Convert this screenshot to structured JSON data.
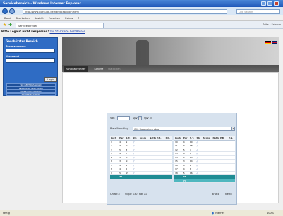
{
  "window": {
    "title": "Servicebereich - Windows Internet Explorer"
  },
  "address": {
    "url": "http://www.golfsuite.de/handicap/login.html",
    "search_placeholder": "Live Search"
  },
  "menu": [
    "Datei",
    "Bearbeiten",
    "Ansicht",
    "Favoriten",
    "Extras",
    "?"
  ],
  "tab": {
    "label": "Servicebereich"
  },
  "favbar_right": "Seite • Extras •",
  "page": {
    "logout_text": "Bitte Logout nicht vergessen!",
    "logout_link": "zur Startseite Golf Kaiser"
  },
  "sidebar": {
    "header": "Geschützter Bereich",
    "username_label": "Benutzername",
    "password_label": "Kennwort",
    "login_button": "Login",
    "links": [
      "SO GEHT DAS LOGIN",
      "KENNWORT VERGESSEN",
      "KENNWORT ANDERN",
      "PRUFEN NEXTBETS"
    ]
  },
  "navtabs": [
    "Handicaprechner",
    "Turniere",
    "Statistiken"
  ],
  "flags": [
    {
      "name": "german-flag-icon",
      "color_top": "#000000",
      "color_mid": "#dd0000",
      "color_bot": "#ffce00"
    },
    {
      "name": "uk-flag-icon",
      "color_top": "#c8102e",
      "color_mid": "#ffffff",
      "color_bot": "#012169"
    }
  ],
  "scorecard": {
    "row1": {
      "label_a": "Von",
      "label_b": "Spv",
      "label_c": "Spv 54"
    },
    "club_label": "Platz/Abschlag",
    "club_value": "C.K. Hosenbirk: rabtal",
    "headers": [
      "Loch",
      "Par",
      "S.T.",
      "Str.",
      "Score",
      "Netto P.B.",
      "P.N."
    ],
    "front": [
      [
        "1",
        "4",
        "9",
        "//"
      ],
      [
        "2",
        "3",
        "17",
        "//"
      ],
      [
        "3",
        "5",
        "3",
        "//"
      ],
      [
        "4",
        "4",
        "7",
        "//"
      ],
      [
        "5",
        "4",
        "11",
        "//"
      ],
      [
        "6",
        "3",
        "13",
        "//"
      ],
      [
        "7",
        "4",
        "1",
        "//"
      ],
      [
        "8",
        "4",
        "5",
        "//"
      ],
      [
        "9",
        "5",
        "15",
        "//"
      ]
    ],
    "back": [
      [
        "10",
        "4",
        "10",
        "//"
      ],
      [
        "11",
        "3",
        "18",
        "//"
      ],
      [
        "12",
        "5",
        "4",
        "//"
      ],
      [
        "13",
        "4",
        "8",
        "//"
      ],
      [
        "14",
        "4",
        "12",
        "//"
      ],
      [
        "15",
        "3",
        "14",
        "//"
      ],
      [
        "16",
        "4",
        "2",
        "//"
      ],
      [
        "17",
        "4",
        "6",
        "//"
      ],
      [
        "18",
        "5",
        "16",
        "//"
      ]
    ],
    "front_sum": "36",
    "back_sum": [
      "35",
      "71"
    ],
    "footer_left": [
      "CR 69.5",
      "Slope 130",
      "Par 71"
    ],
    "footer_right": [
      "Brutto",
      "Netto"
    ],
    "btn_drucken": "Drucken",
    "btn_berechnen": "Berechnen"
  },
  "status": {
    "left": "Fertig",
    "zone": "Internet",
    "zoom": "100%"
  }
}
